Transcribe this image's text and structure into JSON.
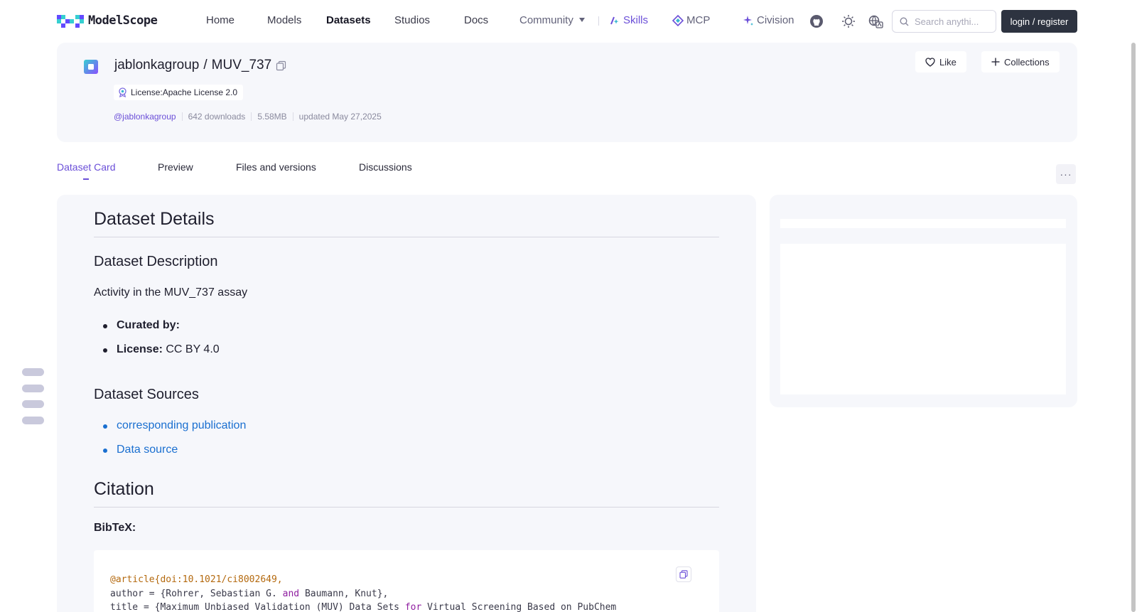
{
  "nav": {
    "logo_text": "ModelScope",
    "links": [
      "Home",
      "Models",
      "Datasets",
      "Studios",
      "Docs"
    ],
    "community": "Community",
    "skills": "Skills",
    "mcp": "MCP",
    "civision": "Civision",
    "search_placeholder": "Search anythi...",
    "login": "login / register"
  },
  "dataset": {
    "owner": "jablonkagroup",
    "slash": "/",
    "name": "MUV_737",
    "license": "License:Apache License 2.0",
    "owner_handle": "@jablonkagroup",
    "downloads": "642 downloads",
    "size": "5.58MB",
    "updated": "updated May 27,2025",
    "like": "Like",
    "collections": "Collections"
  },
  "tabs": [
    "Dataset Card",
    "Preview",
    "Files and versions",
    "Discussions"
  ],
  "card": {
    "h_details": "Dataset Details",
    "h_description": "Dataset Description",
    "description": "Activity in the MUV_737 assay",
    "curated_label": "Curated by:",
    "license_label": "License:",
    "license_value": " CC BY 4.0",
    "h_sources": "Dataset Sources",
    "source_links": [
      "corresponding publication",
      "Data source"
    ],
    "h_citation": "Citation",
    "bibtex_label": "BibTeX:",
    "code": {
      "line1": "@article{doi:10.1021/ci8002649,",
      "line2_a": "author = {Rohrer, Sebastian G. ",
      "line2_kw": "and",
      "line2_b": " Baumann, Knut},",
      "line3_a": "title = {Maximum Unbiased Validation (MUV) Data Sets ",
      "line3_kw": "for",
      "line3_b": " Virtual Screening Based on PubChem"
    }
  },
  "colors": {
    "accent": "#6b4fd8",
    "link": "#1a6fd0",
    "card_bg": "#f6f7fb",
    "login_bg": "#2d3340"
  }
}
